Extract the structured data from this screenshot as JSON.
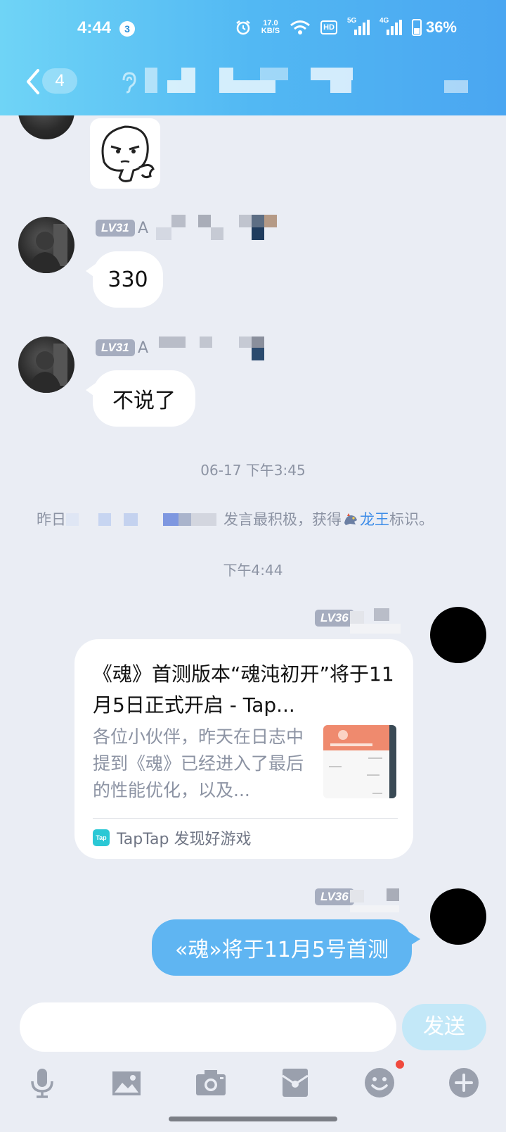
{
  "status_bar": {
    "time": "4:44",
    "notification_count": "3",
    "net_speed_value": "17.0",
    "net_speed_unit": "KB/S",
    "hd_label": "HD",
    "signal1_label": "5G",
    "signal2_label": "4G",
    "battery": "36%"
  },
  "nav": {
    "unread_count": "4"
  },
  "messages": [
    {
      "level": "LV31",
      "nick_prefix": "A",
      "text": "330"
    },
    {
      "level": "LV31",
      "nick_prefix": "A",
      "text": "不说了"
    },
    {
      "level": "LV36",
      "text": "«魂»将于11月5号首测"
    }
  ],
  "timestamps": [
    "06-17 下午3:45",
    "下午4:44"
  ],
  "system_message": {
    "prefix": "昨日",
    "middle": "发言最积极，获得",
    "highlight": "龙王",
    "suffix": "标识。"
  },
  "link_card": {
    "level": "LV36",
    "title": "《魂》首测版本“魂沌初开”将于11月5日正式开启 - Tap...",
    "description": "各位小伙伴，昨天在日志中提到《魂》已经进入了最后的性能优化，以及...",
    "source_icon": "Tap",
    "source": "TapTap 发现好游戏"
  },
  "input": {
    "value": "",
    "send_label": "发送"
  },
  "toolbar": [
    "mic-icon",
    "image-icon",
    "camera-icon",
    "red-packet-icon",
    "emoji-icon",
    "plus-icon"
  ],
  "colors": {
    "header_gradient_start": "#6fd4f6",
    "header_gradient_end": "#4aa6f1",
    "my_bubble": "#5fb5f2",
    "highlight": "#3e8de8",
    "background": "#eaedf4"
  }
}
